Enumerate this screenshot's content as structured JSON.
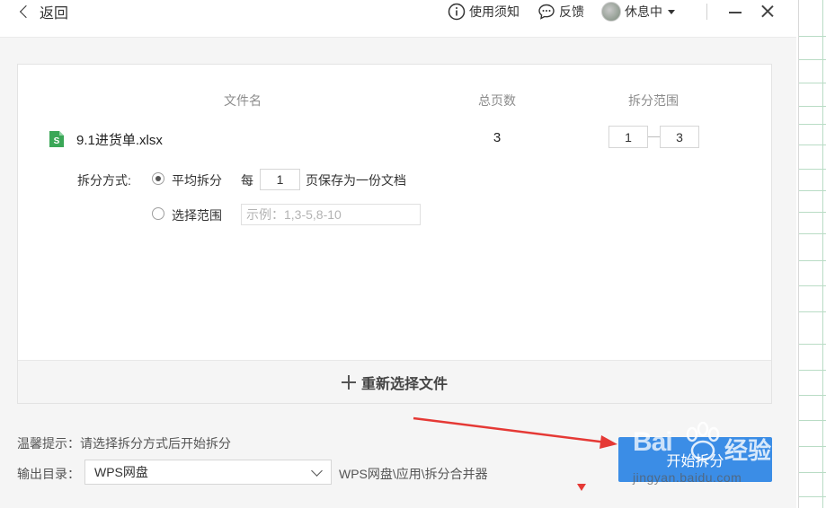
{
  "titlebar": {
    "back_label": "返回",
    "help_label": "使用须知",
    "feedback_label": "反馈",
    "user_status": "休息中"
  },
  "table": {
    "headers": [
      "文件名",
      "总页数",
      "拆分范围"
    ],
    "file": {
      "name": "9.1进货单.xlsx",
      "page_count": "3",
      "range_from": "1",
      "range_to": "3"
    }
  },
  "split_mode": {
    "label": "拆分方式:",
    "options": [
      {
        "label": "平均拆分",
        "checked": true
      },
      {
        "label": "选择范围",
        "checked": false
      }
    ],
    "per_prefix": "每",
    "pages_per_doc": "1",
    "per_suffix": "页保存为一份文档",
    "range_placeholder": "示例：1,3-5,8-10"
  },
  "reselect_label": "重新选择文件",
  "tip": "温馨提示：请选择拆分方式后开始拆分",
  "output": {
    "label": "输出目录：",
    "selected": "WPS网盘",
    "path": "WPS网盘\\应用\\拆分合并器"
  },
  "start_button_label": "开始拆分",
  "watermark": {
    "logo": "Bai",
    "brand": "经验",
    "url": "jingyan.baidu.com"
  },
  "colors": {
    "primary_button": "#3b8de6",
    "annotation_arrow": "#e53935",
    "file_icon": "#3aa757"
  }
}
